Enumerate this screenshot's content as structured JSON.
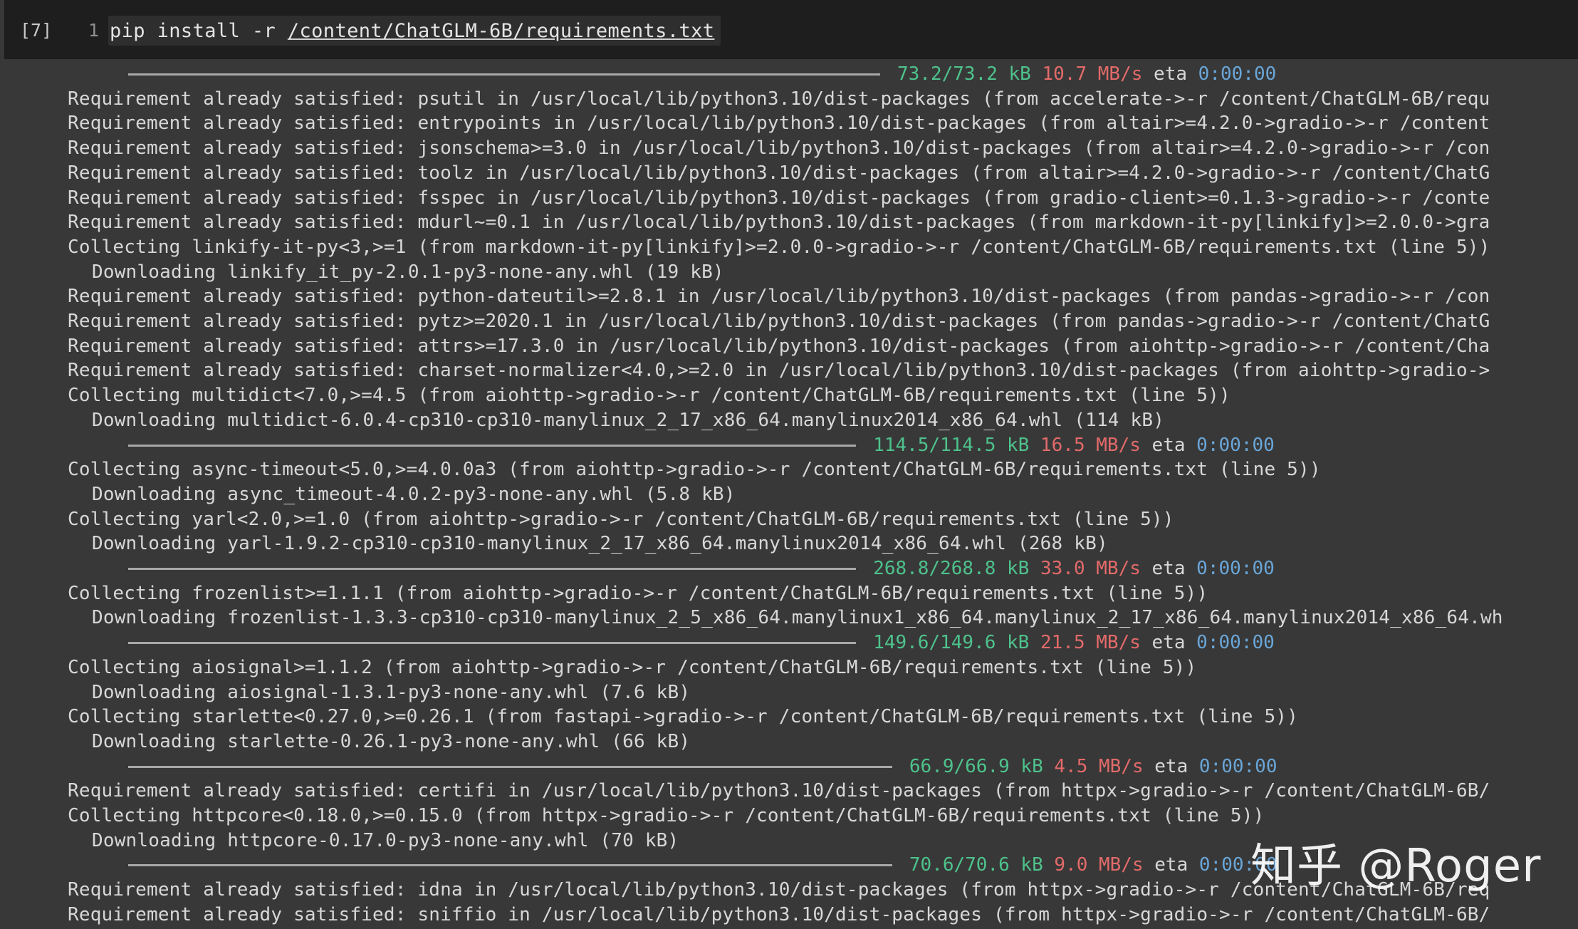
{
  "cell": {
    "prompt": "[7]",
    "line_number": "1",
    "command": "pip install -r ",
    "command_path": "/content/ChatGLM-6B/requirements.txt"
  },
  "output": [
    {
      "kind": "progress",
      "size": "73.2/73.2 kB",
      "speed": "10.7 MB/s",
      "eta_label": "eta",
      "eta": "0:00:00"
    },
    {
      "kind": "text",
      "text": "Requirement already satisfied: psutil in /usr/local/lib/python3.10/dist-packages (from accelerate->-r /content/ChatGLM-6B/requ"
    },
    {
      "kind": "text",
      "text": "Requirement already satisfied: entrypoints in /usr/local/lib/python3.10/dist-packages (from altair>=4.2.0->gradio->-r /content"
    },
    {
      "kind": "text",
      "text": "Requirement already satisfied: jsonschema>=3.0 in /usr/local/lib/python3.10/dist-packages (from altair>=4.2.0->gradio->-r /con"
    },
    {
      "kind": "text",
      "text": "Requirement already satisfied: toolz in /usr/local/lib/python3.10/dist-packages (from altair>=4.2.0->gradio->-r /content/ChatG"
    },
    {
      "kind": "text",
      "text": "Requirement already satisfied: fsspec in /usr/local/lib/python3.10/dist-packages (from gradio-client>=0.1.3->gradio->-r /conte"
    },
    {
      "kind": "text",
      "text": "Requirement already satisfied: mdurl~=0.1 in /usr/local/lib/python3.10/dist-packages (from markdown-it-py[linkify]>=2.0.0->gra"
    },
    {
      "kind": "text",
      "text": "Collecting linkify-it-py<3,>=1 (from markdown-it-py[linkify]>=2.0.0->gradio->-r /content/ChatGLM-6B/requirements.txt (line 5))"
    },
    {
      "kind": "indent",
      "text": "Downloading linkify_it_py-2.0.1-py3-none-any.whl (19 kB)"
    },
    {
      "kind": "text",
      "text": "Requirement already satisfied: python-dateutil>=2.8.1 in /usr/local/lib/python3.10/dist-packages (from pandas->gradio->-r /con"
    },
    {
      "kind": "text",
      "text": "Requirement already satisfied: pytz>=2020.1 in /usr/local/lib/python3.10/dist-packages (from pandas->gradio->-r /content/ChatG"
    },
    {
      "kind": "text",
      "text": "Requirement already satisfied: attrs>=17.3.0 in /usr/local/lib/python3.10/dist-packages (from aiohttp->gradio->-r /content/Cha"
    },
    {
      "kind": "text",
      "text": "Requirement already satisfied: charset-normalizer<4.0,>=2.0 in /usr/local/lib/python3.10/dist-packages (from aiohttp->gradio->"
    },
    {
      "kind": "text",
      "text": "Collecting multidict<7.0,>=4.5 (from aiohttp->gradio->-r /content/ChatGLM-6B/requirements.txt (line 5))"
    },
    {
      "kind": "indent",
      "text": "Downloading multidict-6.0.4-cp310-cp310-manylinux_2_17_x86_64.manylinux2014_x86_64.whl (114 kB)"
    },
    {
      "kind": "progress",
      "size": "114.5/114.5 kB",
      "speed": "16.5 MB/s",
      "eta_label": "eta",
      "eta": "0:00:00"
    },
    {
      "kind": "text",
      "text": "Collecting async-timeout<5.0,>=4.0.0a3 (from aiohttp->gradio->-r /content/ChatGLM-6B/requirements.txt (line 5))"
    },
    {
      "kind": "indent",
      "text": "Downloading async_timeout-4.0.2-py3-none-any.whl (5.8 kB)"
    },
    {
      "kind": "text",
      "text": "Collecting yarl<2.0,>=1.0 (from aiohttp->gradio->-r /content/ChatGLM-6B/requirements.txt (line 5))"
    },
    {
      "kind": "indent",
      "text": "Downloading yarl-1.9.2-cp310-cp310-manylinux_2_17_x86_64.manylinux2014_x86_64.whl (268 kB)"
    },
    {
      "kind": "progress",
      "size": "268.8/268.8 kB",
      "speed": "33.0 MB/s",
      "eta_label": "eta",
      "eta": "0:00:00"
    },
    {
      "kind": "text",
      "text": "Collecting frozenlist>=1.1.1 (from aiohttp->gradio->-r /content/ChatGLM-6B/requirements.txt (line 5))"
    },
    {
      "kind": "indent",
      "text": "Downloading frozenlist-1.3.3-cp310-cp310-manylinux_2_5_x86_64.manylinux1_x86_64.manylinux_2_17_x86_64.manylinux2014_x86_64.wh"
    },
    {
      "kind": "progress",
      "size": "149.6/149.6 kB",
      "speed": "21.5 MB/s",
      "eta_label": "eta",
      "eta": "0:00:00"
    },
    {
      "kind": "text",
      "text": "Collecting aiosignal>=1.1.2 (from aiohttp->gradio->-r /content/ChatGLM-6B/requirements.txt (line 5))"
    },
    {
      "kind": "indent",
      "text": "Downloading aiosignal-1.3.1-py3-none-any.whl (7.6 kB)"
    },
    {
      "kind": "text",
      "text": "Collecting starlette<0.27.0,>=0.26.1 (from fastapi->gradio->-r /content/ChatGLM-6B/requirements.txt (line 5))"
    },
    {
      "kind": "indent",
      "text": "Downloading starlette-0.26.1-py3-none-any.whl (66 kB)"
    },
    {
      "kind": "progress",
      "size": "66.9/66.9 kB",
      "speed": "4.5 MB/s",
      "eta_label": "eta",
      "eta": "0:00:00"
    },
    {
      "kind": "text",
      "text": "Requirement already satisfied: certifi in /usr/local/lib/python3.10/dist-packages (from httpx->gradio->-r /content/ChatGLM-6B/"
    },
    {
      "kind": "text",
      "text": "Collecting httpcore<0.18.0,>=0.15.0 (from httpx->gradio->-r /content/ChatGLM-6B/requirements.txt (line 5))"
    },
    {
      "kind": "indent",
      "text": "Downloading httpcore-0.17.0-py3-none-any.whl (70 kB)"
    },
    {
      "kind": "progress",
      "size": "70.6/70.6 kB",
      "speed": "9.0 MB/s",
      "eta_label": "eta",
      "eta": "0:00:00"
    },
    {
      "kind": "text",
      "text": "Requirement already satisfied: idna in /usr/local/lib/python3.10/dist-packages (from httpx->gradio->-r /content/ChatGLM-6B/req"
    },
    {
      "kind": "text",
      "text": "Requirement already satisfied: sniffio in /usr/local/lib/python3.10/dist-packages (from httpx->gradio->-r /content/ChatGLM-6B/"
    }
  ],
  "watermark": "知乎 @Roger",
  "colors": {
    "size": "#4ec28c",
    "speed": "#e36a6a",
    "eta": "#6aa6d8"
  }
}
